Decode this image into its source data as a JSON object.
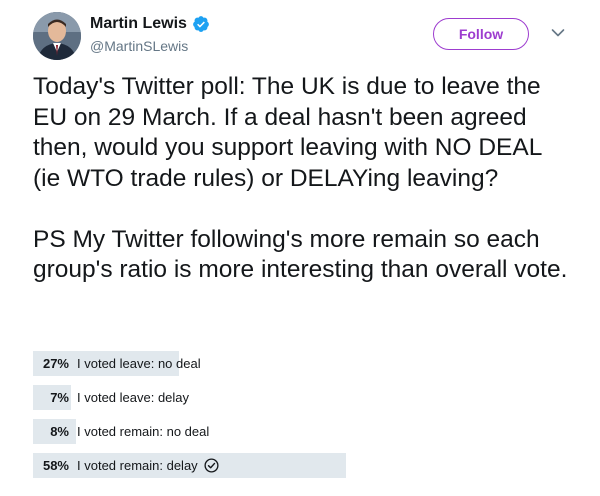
{
  "author": {
    "name": "Martin Lewis",
    "handle": "@MartinSLewis",
    "verified": true,
    "avatar": "profile-photo"
  },
  "header": {
    "follow_label": "Follow",
    "menu_icon": "chevron-down-icon"
  },
  "tweet": {
    "paragraph_1": "Today's Twitter poll: The UK is due to leave the EU on 29 March. If a deal hasn't been agreed then, would you support leaving with NO DEAL (ie WTO trade rules) or DELAYing leaving?",
    "paragraph_2": "PS My Twitter following's more remain so each group's ratio is more interesting than overall vote."
  },
  "poll": {
    "bar_color": "#e1e8ed",
    "options": [
      {
        "percent_label": "27%",
        "fraction": 0.27,
        "label": "I voted leave: no deal",
        "selected": false
      },
      {
        "percent_label": "7%",
        "fraction": 0.07,
        "label": "I voted leave: delay",
        "selected": false
      },
      {
        "percent_label": "8%",
        "fraction": 0.08,
        "label": "I voted remain: no deal",
        "selected": false
      },
      {
        "percent_label": "58%",
        "fraction": 0.58,
        "label": "I voted remain: delay",
        "selected": true
      }
    ]
  },
  "colors": {
    "accent": "#9d3ccf",
    "verified": "#1da1f2",
    "secondary_text": "#657786",
    "primary_text": "#14171a"
  }
}
